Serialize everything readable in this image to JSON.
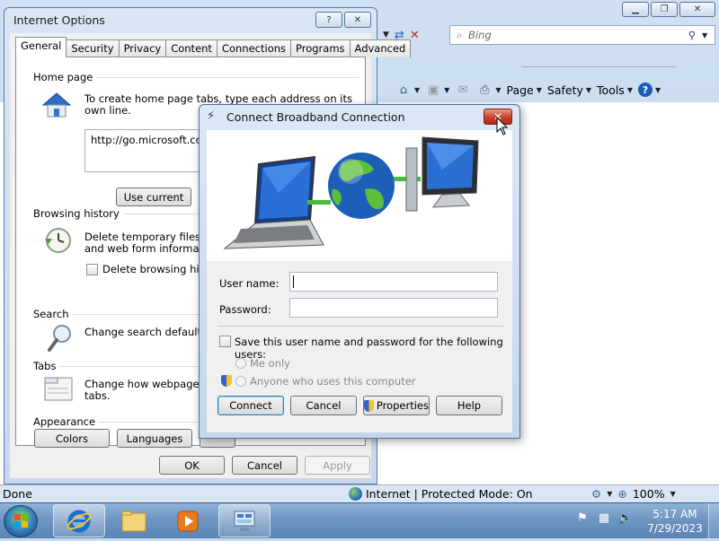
{
  "ie": {
    "search_placeholder": "Bing",
    "toolbar": {
      "page_label": "Page",
      "safety_label": "Safety",
      "tools_label": "Tools"
    },
    "status": {
      "done": "Done",
      "zone": "Internet | Protected Mode: On",
      "zoom": "100%"
    }
  },
  "internet_options": {
    "title": "Internet Options",
    "help_glyph": "?",
    "close_glyph": "✕",
    "tabs": [
      "General",
      "Security",
      "Privacy",
      "Content",
      "Connections",
      "Programs",
      "Advanced"
    ],
    "home_page": {
      "label": "Home page",
      "description": "To create home page tabs, type each address on its own line.",
      "url": "http://go.microsoft.com/",
      "use_current_label": "Use current"
    },
    "browsing_history": {
      "label": "Browsing history",
      "description_line1": "Delete temporary files, histo",
      "description_line2": "and web form information.",
      "checkbox_label": "Delete browsing history o"
    },
    "search": {
      "label": "Search",
      "description": "Change search defaults."
    },
    "tabs_group": {
      "label": "Tabs",
      "description_line1": "Change how webpages are",
      "description_line2": "tabs."
    },
    "appearance": {
      "label": "Appearance",
      "colors_label": "Colors",
      "languages_label": "Languages"
    },
    "ok_label": "OK",
    "cancel_label": "Cancel",
    "apply_label": "Apply"
  },
  "connect_dialog": {
    "title": "Connect Broadband Connection",
    "close_glyph": "✕",
    "username_label": "User name:",
    "username_value": "",
    "password_label": "Password:",
    "password_value": "",
    "save_label": "Save this user name and password for the following users:",
    "me_only_label": "Me only",
    "anyone_label": "Anyone who uses this computer",
    "connect_label": "Connect",
    "cancel_label": "Cancel",
    "properties_label": "Properties",
    "help_label": "Help"
  },
  "taskbar": {
    "time": "5:17 AM",
    "date": "7/29/2023"
  },
  "colors": {
    "accent": "#3c7fb1",
    "close_red": "#c8412a"
  }
}
